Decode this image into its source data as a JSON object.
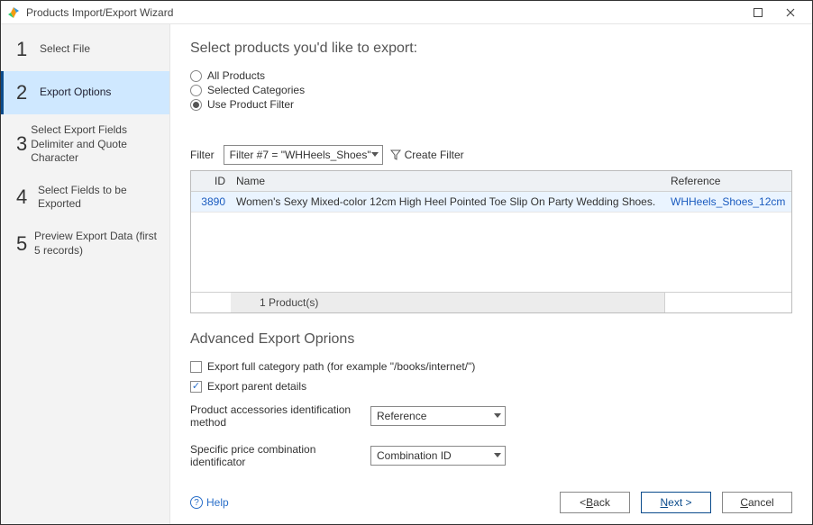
{
  "window": {
    "title": "Products Import/Export Wizard"
  },
  "sidebar": {
    "steps": [
      {
        "num": "1",
        "label": "Select File"
      },
      {
        "num": "2",
        "label": "Export Options"
      },
      {
        "num": "3",
        "label": "Select Export Fields Delimiter and Quote Character"
      },
      {
        "num": "4",
        "label": "Select Fields to be Exported"
      },
      {
        "num": "5",
        "label": "Preview Export Data (first 5 records)"
      }
    ]
  },
  "main": {
    "heading": "Select products you'd like to export:",
    "radios": {
      "all": "All Products",
      "categories": "Selected Categories",
      "filter": "Use Product Filter"
    },
    "filter": {
      "label": "Filter",
      "selected": "Filter #7 = \"WHHeels_Shoes\"",
      "create": "Create Filter"
    },
    "grid": {
      "columns": {
        "id": "ID",
        "name": "Name",
        "reference": "Reference"
      },
      "rows": [
        {
          "id": "3890",
          "name": "Women's Sexy Mixed-color 12cm High Heel Pointed Toe Slip On Party Wedding Shoes.",
          "reference": "WHHeels_Shoes_12cm"
        }
      ],
      "count_label": "1 Product(s)"
    },
    "advanced": {
      "heading": "Advanced Export Oprions",
      "export_full_path": "Export full category path (for example \"/books/internet/\")",
      "export_parent": "Export parent details",
      "id_method_label": "Product accessories identification method",
      "id_method_value": "Reference",
      "combo_label": "Specific price combination identificator",
      "combo_value": "Combination ID"
    }
  },
  "footer": {
    "help": "Help",
    "back_prefix": "< ",
    "back_letter": "B",
    "back_rest": "ack",
    "next_letter": "N",
    "next_rest": "ext >",
    "cancel_letter": "C",
    "cancel_rest": "ancel"
  }
}
